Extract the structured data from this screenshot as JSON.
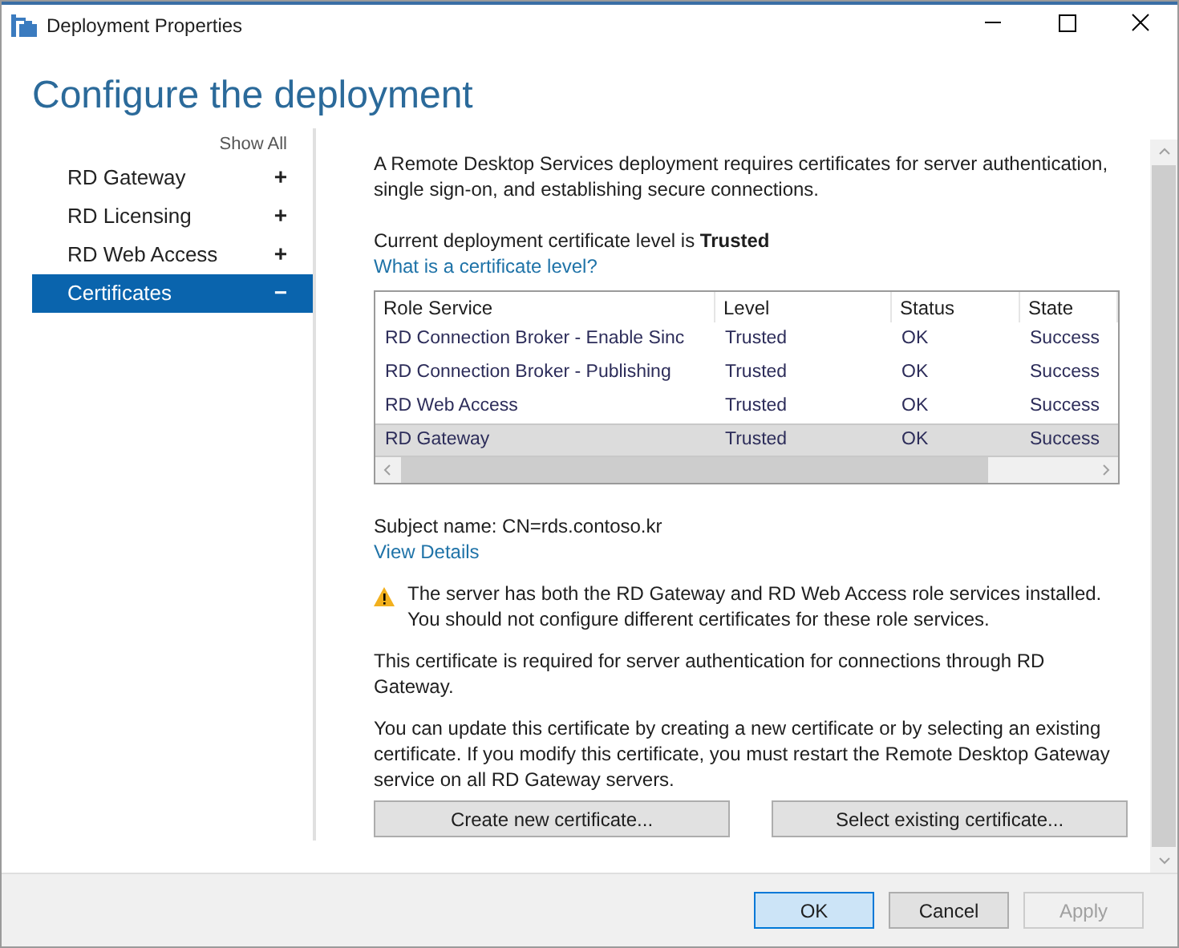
{
  "window": {
    "title": "Deployment Properties"
  },
  "heading": "Configure the deployment",
  "sidebar": {
    "show_all": "Show All",
    "items": [
      {
        "label": "RD Gateway",
        "toggle": "+",
        "selected": false
      },
      {
        "label": "RD Licensing",
        "toggle": "+",
        "selected": false
      },
      {
        "label": "RD Web Access",
        "toggle": "+",
        "selected": false
      },
      {
        "label": "Certificates",
        "toggle": "−",
        "selected": true
      }
    ]
  },
  "intro": "A Remote Desktop Services deployment requires certificates for server authentication, single sign-on, and establishing secure connections.",
  "level_text": "Current deployment certificate level is **Trusted**",
  "level_link": "What is a certificate level?",
  "table": {
    "columns": [
      "Role Service",
      "Level",
      "Status",
      "State"
    ],
    "rows": [
      {
        "cells": [
          "RD Connection Broker - Enable Sinc",
          "Trusted",
          "OK",
          "Success"
        ],
        "selected": false
      },
      {
        "cells": [
          "RD Connection Broker - Publishing",
          "Trusted",
          "OK",
          "Success"
        ],
        "selected": false
      },
      {
        "cells": [
          "RD Web Access",
          "Trusted",
          "OK",
          "Success"
        ],
        "selected": false
      },
      {
        "cells": [
          "RD Gateway",
          "Trusted",
          "OK",
          "Success"
        ],
        "selected": true
      }
    ]
  },
  "subject": "Subject name: CN=rds.contoso.kr",
  "details_link": "View Details",
  "warning": "The server has both the RD Gateway and RD Web Access role services installed. You should not configure different certificates for these role services.",
  "paragraphs": [
    "This certificate is required for server authentication for connections through RD Gateway.",
    "You can update this certificate by creating a new certificate or by selecting an existing certificate. If you modify this certificate, you must restart the Remote Desktop Gateway service on all RD Gateway servers."
  ],
  "actions": [
    "Create new certificate...",
    "Select existing certificate..."
  ],
  "buttons": [
    {
      "label": "OK",
      "default": true,
      "disabled": false
    },
    {
      "label": "Cancel",
      "default": false,
      "disabled": false
    },
    {
      "label": "Apply",
      "default": false,
      "disabled": true
    }
  ]
}
